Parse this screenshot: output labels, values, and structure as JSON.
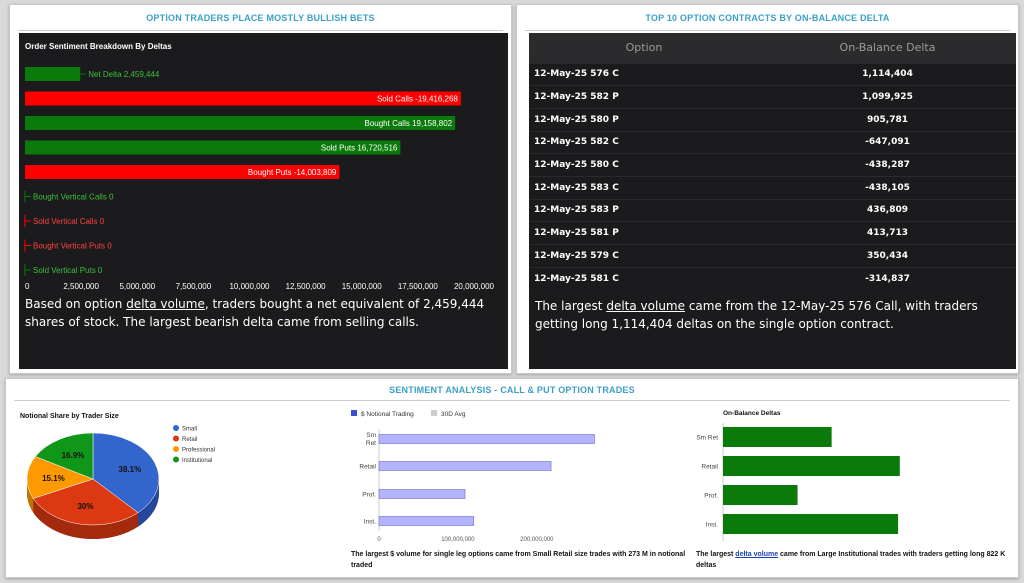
{
  "panels": {
    "bullish": {
      "title": "OPTION TRADERS PLACE MOSTLY BULLISH BETS",
      "summary_before": "Based on option ",
      "summary_link": "delta volume",
      "summary_after": ", traders bought a net equivalent of 2,459,444 shares of stock. The largest bearish delta came from selling calls."
    },
    "top10": {
      "title": "TOP 10 OPTION CONTRACTS BY ON-BALANCE DELTA",
      "col_option": "Option",
      "col_delta": "On-Balance Delta",
      "rows": [
        {
          "option": "12-May-25 576 C",
          "delta": "1,114,404"
        },
        {
          "option": "12-May-25 582 P",
          "delta": "1,099,925"
        },
        {
          "option": "12-May-25 580 P",
          "delta": "905,781"
        },
        {
          "option": "12-May-25 582 C",
          "delta": "-647,091"
        },
        {
          "option": "12-May-25 580 C",
          "delta": "-438,287"
        },
        {
          "option": "12-May-25 583 C",
          "delta": "-438,105"
        },
        {
          "option": "12-May-25 583 P",
          "delta": "436,809"
        },
        {
          "option": "12-May-25 581 P",
          "delta": "413,713"
        },
        {
          "option": "12-May-25 579 C",
          "delta": "350,434"
        },
        {
          "option": "12-May-25 581 C",
          "delta": "-314,837"
        }
      ],
      "summary_before": "The largest ",
      "summary_link": "delta volume",
      "summary_after": " came from the 12-May-25 576 Call, with traders getting long 1,114,404 deltas on the single option contract."
    },
    "sentiment": {
      "title": "SENTIMENT ANALYSIS - CALL & PUT OPTION TRADES",
      "notional_caption": "The largest $ volume for single leg options came from Small Retail size trades with 273 M in notional traded",
      "obd_caption_before": "The largest ",
      "obd_caption_link": "delta volume",
      "obd_caption_after": " came from Large Institutional trades with traders getting long 822 K deltas"
    }
  },
  "chart_data": [
    {
      "type": "bar",
      "orientation": "horizontal",
      "title": "Order Sentiment Breakdown By Deltas",
      "categories": [
        "Net Delta",
        "Sold Calls",
        "Bought Calls",
        "Sold Puts",
        "Bought Puts",
        "Bought Vertical Calls",
        "Sold Vertical Calls",
        "Bought Vertical Puts",
        "Sold Vertical Puts"
      ],
      "values": [
        2459444,
        -19416268,
        19158802,
        16720516,
        -14003809,
        0,
        0,
        0,
        0
      ],
      "labels": [
        "Net Delta 2,459,444",
        "Sold Calls -19,416,268",
        "Bought Calls 19,158,802",
        "Sold Puts 16,720,516",
        "Bought Puts -14,003,809",
        "Bought Vertical Calls 0",
        "Sold Vertical Calls 0",
        "Bought Vertical Puts 0",
        "Sold Vertical Puts 0"
      ],
      "colors": [
        "#0a7a0a",
        "#ff0000",
        "#0a7a0a",
        "#0a7a0a",
        "#ff0000",
        "#0a7a0a",
        "#ff0000",
        "#ff0000",
        "#0a7a0a"
      ],
      "xlim": [
        0,
        20000000
      ],
      "xticks": [
        "0",
        "2,500,000",
        "5,000,000",
        "7,500,000",
        "10,000,000",
        "12,500,000",
        "15,000,000",
        "17,500,000",
        "20,000,000"
      ]
    },
    {
      "type": "pie",
      "title": "Notional Share by Trader Size",
      "categories": [
        "Small",
        "Retail",
        "Professional",
        "Institutional"
      ],
      "values": [
        38.1,
        30,
        15.1,
        16.9
      ],
      "labels": [
        "38.1%",
        "30%",
        "15.1%",
        "16.9%"
      ],
      "colors": [
        "#3366cc",
        "#dc3912",
        "#ff9900",
        "#109618"
      ],
      "legend": "right"
    },
    {
      "type": "bar",
      "orientation": "horizontal",
      "categories": [
        "Sm Ret",
        "Retail",
        "Prof.",
        "Inst."
      ],
      "series": [
        {
          "name": "$ Notional Trading",
          "values": [
            273000000,
            218000000,
            109000000,
            120000000
          ],
          "color": "#b3b3ff"
        },
        {
          "name": "30D Avg",
          "values": [
            0,
            0,
            0,
            0
          ],
          "color": "#cccccc"
        }
      ],
      "xticks": [
        "0",
        "100,000,000",
        "200,000,000"
      ],
      "xlim": [
        0,
        370000000
      ],
      "legend": "top"
    },
    {
      "type": "bar",
      "orientation": "horizontal",
      "title": "On-Balance Deltas",
      "categories": [
        "Sm Ret",
        "Retail",
        "Prof.",
        "Inst."
      ],
      "values": [
        510000,
        830000,
        350000,
        822000
      ],
      "colors": [
        "#0a7a0a",
        "#0a7a0a",
        "#0a7a0a",
        "#0a7a0a"
      ]
    }
  ]
}
